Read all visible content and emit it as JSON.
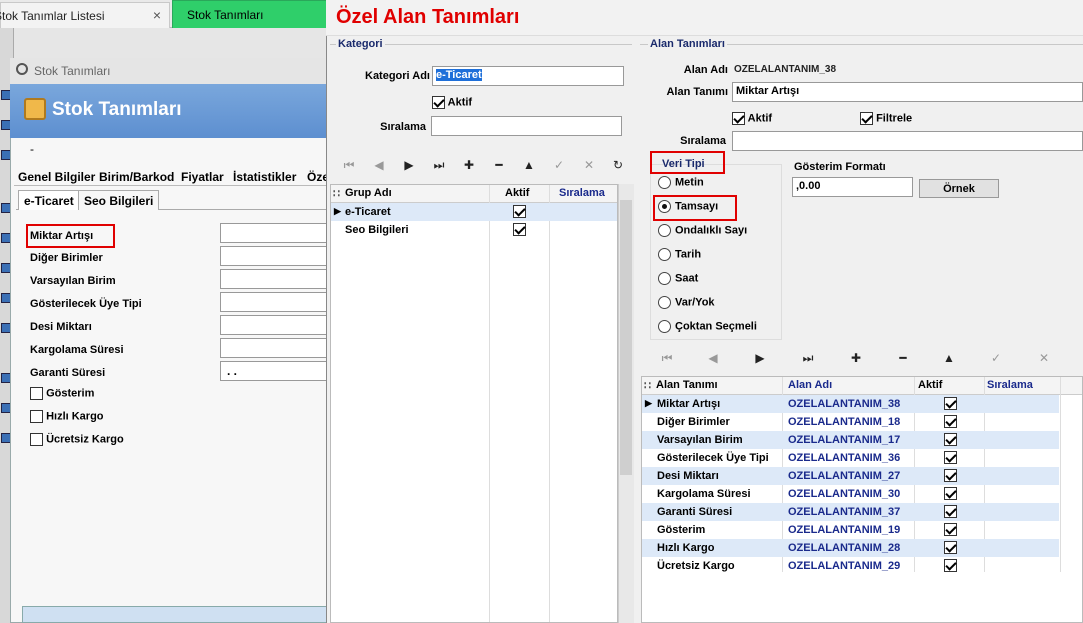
{
  "tabs": [
    {
      "label": "Stok Tanımlar Listesi",
      "close": "×"
    },
    {
      "label": "Stok Tanımları"
    }
  ],
  "left_window": {
    "title": "Stok Tanımları",
    "header": "Stok Tanımları",
    "dash": "-",
    "menu": [
      "Genel Bilgiler",
      "Birim/Barkod",
      "Fiyatlar",
      "İstatistikler",
      "Öze"
    ],
    "subtabs": [
      "e-Ticaret",
      "Seo Bilgileri"
    ],
    "fields": [
      "Miktar Artışı",
      "Diğer Birimler",
      "Varsayılan  Birim",
      "Gösterilecek Üye Tipi",
      "Desi Miktarı",
      "Kargolama Süresi",
      "Garanti Süresi"
    ],
    "garanti_value": ". .",
    "checks": [
      "Gösterim",
      "Hızlı Kargo",
      "Ücretsiz Kargo"
    ]
  },
  "dialog": {
    "title": "Özel Alan Tanımları",
    "kategori": {
      "group": "Kategori",
      "name_label": "Kategori Adı",
      "name_value": "e-Ticaret",
      "aktif_label": "Aktif",
      "sira_label": "Sıralama",
      "nav": [
        "⏮",
        "◀",
        "▶",
        "⏭",
        "✚",
        "━",
        "▲",
        "✓",
        "✕",
        "↻"
      ],
      "grid": {
        "columns": [
          "Grup Adı",
          "Aktif",
          "Sıralama"
        ],
        "rows": [
          {
            "name": "e-Ticaret",
            "aktif": true
          },
          {
            "name": "Seo Bilgileri",
            "aktif": true
          }
        ]
      }
    },
    "alan": {
      "group": "Alan Tanımları",
      "adi_label": "Alan Adı",
      "adi_value": "OZELALANTANIM_38",
      "tanim_label": "Alan Tanımı",
      "tanim_value": "Miktar Artışı",
      "aktif_label": "Aktif",
      "filtrele_label": "Filtrele",
      "sira_label": "Sıralama",
      "veri_tipi_label": "Veri Tipi",
      "veri_tipleri": [
        "Metin",
        "Tamsayı",
        "Ondalıklı Sayı",
        "Tarih",
        "Saat",
        "Var/Yok",
        "Çoktan Seçmeli"
      ],
      "selected_veri_tipi": "Tamsayı",
      "format_label": "Gösterim Formatı",
      "format_value": ",0.00",
      "ornek_button": "Örnek",
      "nav": [
        "⏮",
        "◀",
        "▶",
        "⏭",
        "✚",
        "━",
        "▲",
        "✓",
        "✕"
      ],
      "grid": {
        "columns": [
          "Alan Tanımı",
          "Alan Adı",
          "Aktif",
          "Sıralama"
        ],
        "rows": [
          {
            "tanim": "Miktar Artışı",
            "adi": "OZELALANTANIM_38",
            "aktif": true
          },
          {
            "tanim": "Diğer Birimler",
            "adi": "OZELALANTANIM_18",
            "aktif": true
          },
          {
            "tanim": "Varsayılan  Birim",
            "adi": "OZELALANTANIM_17",
            "aktif": true
          },
          {
            "tanim": "Gösterilecek Üye Tipi",
            "adi": "OZELALANTANIM_36",
            "aktif": true
          },
          {
            "tanim": "Desi Miktarı",
            "adi": "OZELALANTANIM_27",
            "aktif": true
          },
          {
            "tanim": "Kargolama Süresi",
            "adi": "OZELALANTANIM_30",
            "aktif": true
          },
          {
            "tanim": "Garanti Süresi",
            "adi": "OZELALANTANIM_37",
            "aktif": true
          },
          {
            "tanim": "Gösterim",
            "adi": "OZELALANTANIM_19",
            "aktif": true
          },
          {
            "tanim": "Hızlı Kargo",
            "adi": "OZELALANTANIM_28",
            "aktif": true
          },
          {
            "tanim": "Ücretsiz Kargo",
            "adi": "OZELALANTANIM_29",
            "aktif": true
          }
        ]
      }
    }
  },
  "colors": {
    "title_red": "#e00000",
    "tab_green": "#2fcf6a",
    "header_blue": "#5d8fd0",
    "row_alt": "#dde9f8",
    "highlight": "#e00000"
  }
}
